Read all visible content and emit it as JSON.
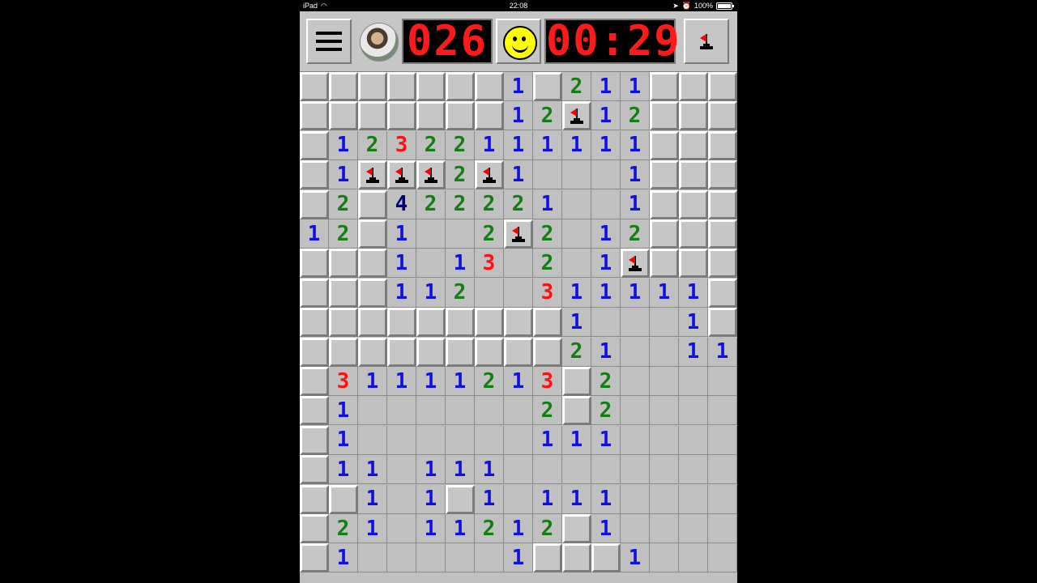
{
  "status_bar": {
    "device": "iPad",
    "time": "22:08",
    "battery": "100%"
  },
  "toolbar": {
    "mine_counter": "026",
    "timer": "00:29"
  },
  "colors": {
    "n1": "#1010e0",
    "n2": "#108010",
    "n3": "#ff1010",
    "n4": "#000080",
    "lcd": "#ff1a1a"
  },
  "icons": [
    "hamburger-menu-icon",
    "avatar",
    "smiley-face-icon",
    "flag-icon"
  ],
  "board": {
    "cols": 15,
    "rows": [
      "HHHHHHH1H211HHH",
      "HHHHHHH12F12HHH",
      "H12322111111HHH",
      "H1FFF2F1...1HHH",
      "H2H42222 1..1HHH",
      "12H1..2F2.12HHH",
      "HHH1.13.2.1FHHH",
      "HHH112..31111 1H",
      "HHHHHHHHH1...1H",
      "HHHHHHHHH21..11",
      "H3111121 3H2....",
      "H1......2H2....",
      "H1......111....",
      "H11.111........",
      "HH1.1H1.111....",
      "H21.11212H1....",
      "H1.....1HHH1..."
    ]
  }
}
